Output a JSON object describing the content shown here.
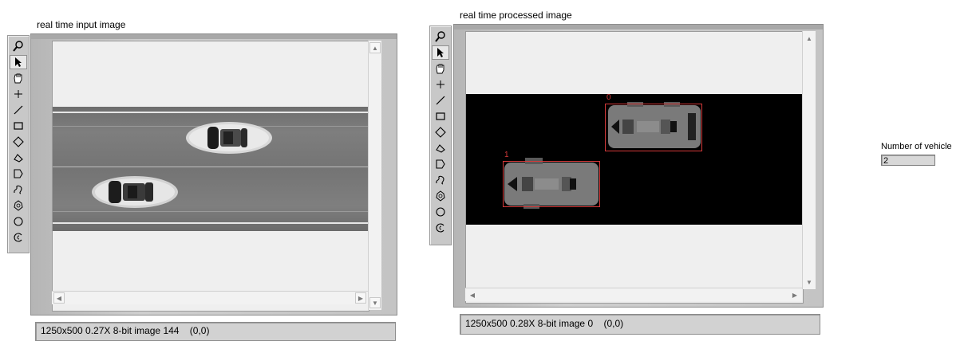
{
  "left_display": {
    "title": "real time input image",
    "status": "1250x500 0.27X 8-bit image 144    (0,0)"
  },
  "right_display": {
    "title": "real time processed image",
    "status": "1250x500 0.28X 8-bit image 0    (0,0)",
    "detections": [
      {
        "label": "0"
      },
      {
        "label": "1"
      }
    ]
  },
  "indicator": {
    "label": "Number of vehicle",
    "value": "2"
  },
  "tools": [
    "zoom-icon",
    "pointer-icon",
    "pan-hand-icon",
    "crosshair-icon",
    "line-icon",
    "rectangle-icon",
    "rotated-rectangle-icon",
    "polygon-icon",
    "freehand-region-icon",
    "freehand-line-icon",
    "annulus-icon",
    "oval-icon",
    "broken-annulus-icon"
  ],
  "colors": {
    "detection_box": "#d43a3a",
    "active_tool": "#e8e8e8"
  }
}
